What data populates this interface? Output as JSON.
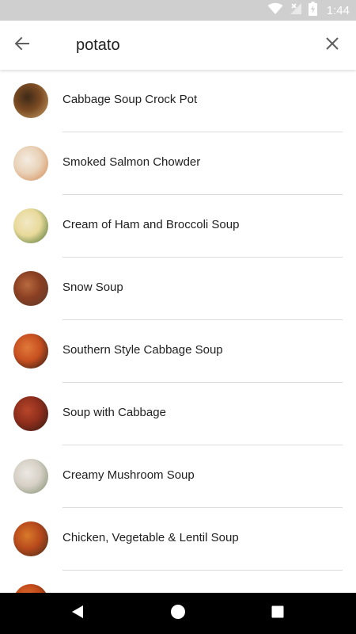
{
  "status_bar": {
    "time": "1:44",
    "icons": [
      "wifi-icon",
      "no-signal-icon",
      "battery-charging-icon"
    ]
  },
  "search": {
    "query": "potato",
    "back_icon": "arrow-left-icon",
    "clear_icon": "close-icon"
  },
  "results": [
    {
      "title": "Cabbage Soup Crock Pot",
      "thumb_colors": [
        "#7a4a22",
        "#c9a26a",
        "#3e2a18"
      ]
    },
    {
      "title": "Smoked Salmon Chowder",
      "thumb_colors": [
        "#e9d2b8",
        "#d2864e",
        "#f4ece2"
      ]
    },
    {
      "title": "Cream of Ham and Broccoli Soup",
      "thumb_colors": [
        "#e8d99a",
        "#3d6b2a",
        "#f2e9c6"
      ]
    },
    {
      "title": "Snow Soup",
      "thumb_colors": [
        "#8a3f22",
        "#5a3a2c",
        "#b86a3e"
      ]
    },
    {
      "title": "Southern Style Cabbage Soup",
      "thumb_colors": [
        "#c75020",
        "#1e1612",
        "#e07a3a"
      ]
    },
    {
      "title": "Soup with Cabbage",
      "thumb_colors": [
        "#8e2e1c",
        "#2a1a14",
        "#b8462a"
      ]
    },
    {
      "title": "Creamy Mushroom Soup",
      "thumb_colors": [
        "#d6d0c6",
        "#7a8a6a",
        "#ece8e2"
      ]
    },
    {
      "title": "Chicken, Vegetable & Lentil Soup",
      "thumb_colors": [
        "#b84a1c",
        "#3a2a1a",
        "#d87a2a"
      ]
    },
    {
      "title": "",
      "thumb_colors": [
        "#c24a1a",
        "#2a1a12",
        "#e07030"
      ]
    }
  ],
  "nav_bar": {
    "back": "nav-back-icon",
    "home": "nav-home-icon",
    "recents": "nav-recents-icon"
  }
}
